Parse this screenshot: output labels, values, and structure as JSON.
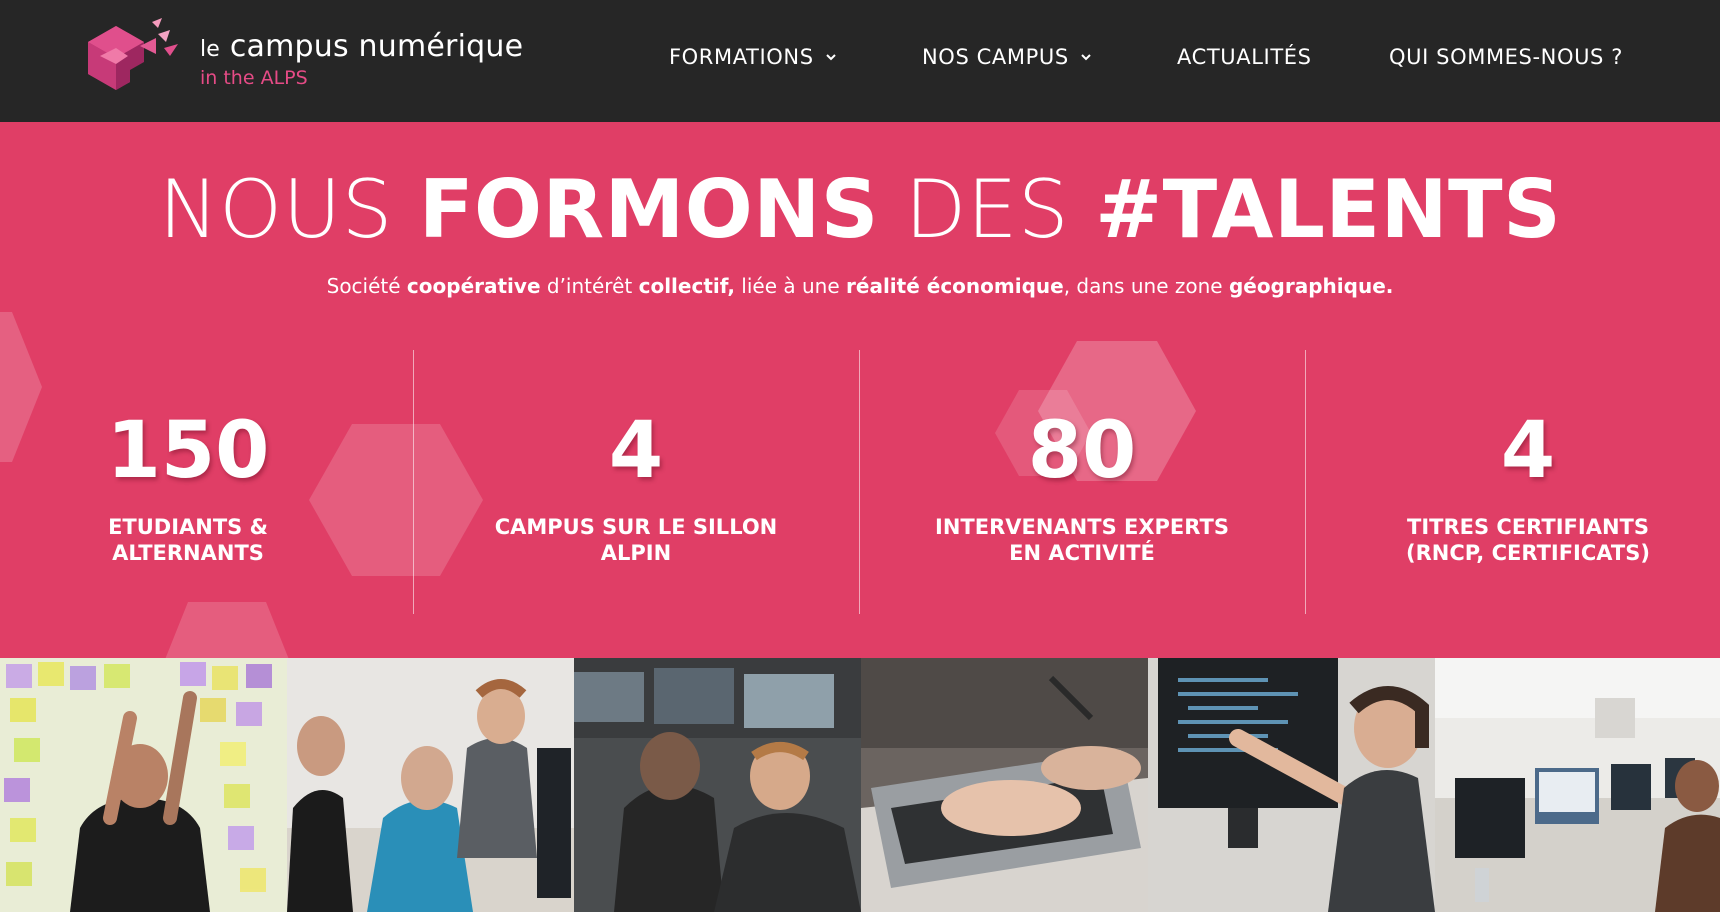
{
  "header": {
    "logo": {
      "prefix": "le",
      "name": "campus numérique",
      "tagline": "in the ALPS"
    },
    "nav": [
      {
        "label": "FORMATIONS",
        "has_dropdown": true,
        "icon": "chevron-down-icon"
      },
      {
        "label": "NOS CAMPUS",
        "has_dropdown": true,
        "icon": "chevron-down-icon"
      },
      {
        "label": "ACTUALITÉS",
        "has_dropdown": false
      },
      {
        "label": "QUI SOMMES-NOUS ?",
        "has_dropdown": false
      }
    ]
  },
  "hero": {
    "title": {
      "w1": "NOUS",
      "b1": "FORMONS",
      "w2": "DES",
      "b2": "#TALENTS"
    },
    "subtitle": {
      "t1": "Société ",
      "b1": "coopérative",
      "t2": " d’intérêt ",
      "b2": "collectif,",
      "t3": " liée à une ",
      "b3": "réalité économique",
      "t4": ", dans une zone ",
      "b4": "géographique."
    },
    "stats": [
      {
        "value": "150",
        "label": "ETUDIANTS & ALTERNANTS"
      },
      {
        "value": "4",
        "label": "CAMPUS SUR LE SILLON ALPIN"
      },
      {
        "value": "80",
        "label": "INTERVENANTS EXPERTS EN ACTIVITÉ"
      },
      {
        "value": "4",
        "label": "TITRES CERTIFIANTS (RNCP, CERTIFICATS)"
      }
    ]
  },
  "colors": {
    "header_bg": "#262626",
    "brand_pink": "#e03e66",
    "logo_accent": "#e64b86"
  },
  "photos": [
    {
      "name": "photo-sticky-notes-wall"
    },
    {
      "name": "photo-group-at-computer"
    },
    {
      "name": "photo-students-at-desks"
    },
    {
      "name": "photo-hands-on-laptop"
    },
    {
      "name": "photo-pointing-at-screen"
    },
    {
      "name": "photo-computer-classroom"
    }
  ]
}
